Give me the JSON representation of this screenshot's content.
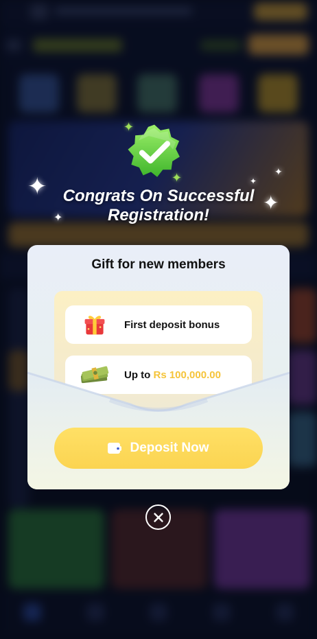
{
  "modal": {
    "headline_line1": "Congrats On Successful",
    "headline_line2": "Registration!",
    "card_title": "Gift for new members",
    "rows": [
      {
        "icon": "gift-box-icon",
        "label": "First deposit bonus"
      },
      {
        "icon": "cash-stack-icon",
        "label_prefix": "Up to ",
        "amount": "Rs 100,000.00"
      }
    ],
    "deposit_button": {
      "label": "Deposit Now",
      "icon": "wallet-icon"
    },
    "close_icon": "close-icon"
  },
  "colors": {
    "accent_yellow": "#fbd451",
    "amount_yellow": "#f5c43a",
    "badge_green": "#6fd43a"
  }
}
